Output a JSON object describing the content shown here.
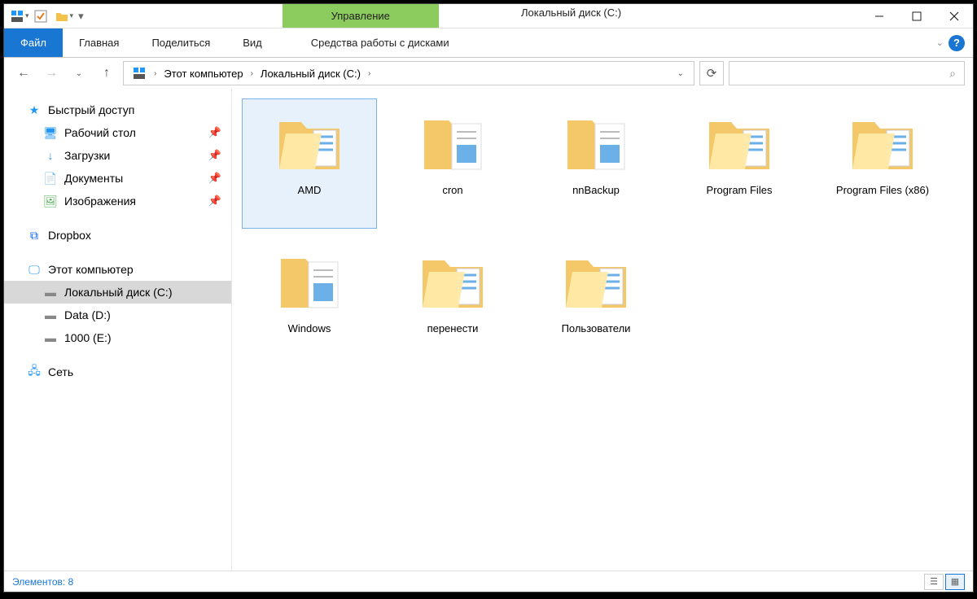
{
  "window_title": "Локальный диск (C:)",
  "context_tab": "Управление",
  "ribbon": {
    "file": "Файл",
    "tabs": [
      "Главная",
      "Поделиться",
      "Вид"
    ],
    "context": "Средства работы с дисками"
  },
  "breadcrumb": {
    "segments": [
      "Этот компьютер",
      "Локальный диск (C:)"
    ]
  },
  "search_placeholder": "",
  "sidebar": {
    "quick_access": "Быстрый доступ",
    "quick_items": [
      {
        "label": "Рабочий стол",
        "pinned": true,
        "icon": "desktop"
      },
      {
        "label": "Загрузки",
        "pinned": true,
        "icon": "downloads"
      },
      {
        "label": "Документы",
        "pinned": true,
        "icon": "documents"
      },
      {
        "label": "Изображения",
        "pinned": true,
        "icon": "pictures"
      }
    ],
    "dropbox": "Dropbox",
    "this_pc": "Этот компьютер",
    "drives": [
      {
        "label": "Локальный диск (C:)",
        "selected": true
      },
      {
        "label": "Data (D:)",
        "selected": false
      },
      {
        "label": "1000 (E:)",
        "selected": false
      }
    ],
    "network": "Сеть"
  },
  "folders": [
    {
      "name": "AMD",
      "type": "closed",
      "selected": true
    },
    {
      "name": "cron",
      "type": "open",
      "selected": false
    },
    {
      "name": "nnBackup",
      "type": "open",
      "selected": false
    },
    {
      "name": "Program Files",
      "type": "closed",
      "selected": false
    },
    {
      "name": "Program Files (x86)",
      "type": "closed",
      "selected": false
    },
    {
      "name": "Windows",
      "type": "open",
      "selected": false
    },
    {
      "name": "перенести",
      "type": "closed",
      "selected": false
    },
    {
      "name": "Пользователи",
      "type": "closed",
      "selected": false
    }
  ],
  "statusbar": {
    "count_label": "Элементов: 8"
  }
}
